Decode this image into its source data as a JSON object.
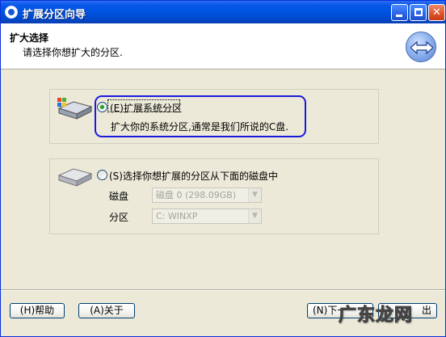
{
  "window": {
    "title": "扩展分区向导",
    "controls": {
      "minimize": "minimize-icon",
      "maximize": "maximize-icon",
      "close": "✕"
    }
  },
  "header": {
    "title": "扩大选择",
    "subtitle": "请选择你想扩大的分区."
  },
  "options": [
    {
      "label": "(E)扩展系统分区",
      "description": "扩大你的系统分区,通常是我们所说的C盘.",
      "selected": true
    },
    {
      "label": "(S)选择你想扩展的分区从下面的磁盘中",
      "selected": false
    }
  ],
  "fields": {
    "disk_label": "磁盘",
    "disk_value": "磁盘 0 (298.09GB)",
    "partition_label": "分区",
    "partition_value": "C: WINXP"
  },
  "buttons": {
    "help": "(H)帮助",
    "about": "(A)关于",
    "next": "(N)下一",
    "exit": "出"
  },
  "watermark": "广东龙网",
  "colors": {
    "titlebar": "#0054e3",
    "highlight_ring": "#1a1adf",
    "radio_dot": "#21a121"
  }
}
